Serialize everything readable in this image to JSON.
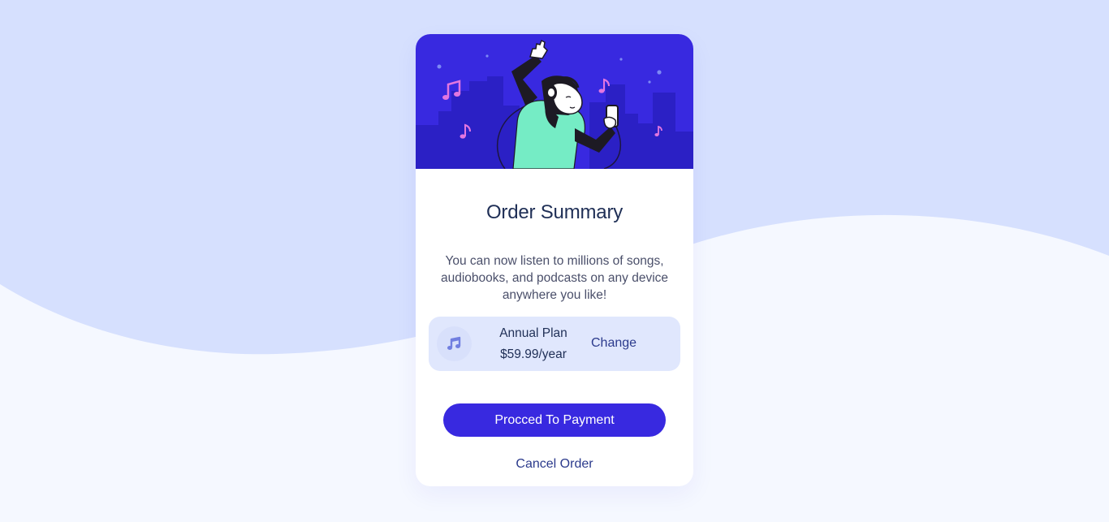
{
  "card": {
    "title": "Order Summary",
    "description": "You can now listen to millions of songs, audiobooks, and podcasts on any device anywhere you like!"
  },
  "plan": {
    "icon": "music-note-icon",
    "name": "Annual Plan",
    "price": "$59.99/year",
    "change_label": "Change"
  },
  "actions": {
    "pay_label": "Procced To Payment",
    "cancel_label": "Cancel Order"
  },
  "colors": {
    "accent": "#3829e0",
    "page_bg_top": "#d6e0fe",
    "page_bg_bottom": "#f5f8ff",
    "plan_bg": "#e0e7fd",
    "title_text": "#1f2f56",
    "body_text": "#4a4f6a",
    "link_text": "#2b3a8c",
    "hero_bg": "#3829e0"
  }
}
